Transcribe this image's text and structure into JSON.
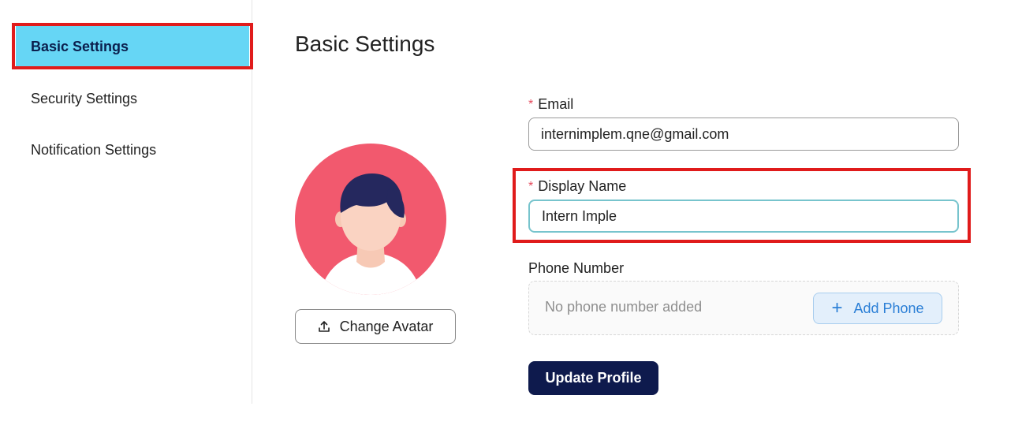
{
  "sidebar": {
    "items": [
      {
        "label": "Basic Settings",
        "active": true
      },
      {
        "label": "Security Settings",
        "active": false
      },
      {
        "label": "Notification Settings",
        "active": false
      }
    ]
  },
  "main": {
    "title": "Basic Settings",
    "avatar": {
      "change_label": "Change Avatar",
      "icon": "upload-icon"
    },
    "form": {
      "email": {
        "label": "Email",
        "required_mark": "*",
        "value": "internimplem.qne@gmail.com"
      },
      "display_name": {
        "label": "Display Name",
        "required_mark": "*",
        "value": "Intern Imple"
      },
      "phone": {
        "label": "Phone Number",
        "empty_text": "No phone number added",
        "add_label": "Add Phone",
        "add_icon": "plus-icon"
      },
      "submit_label": "Update Profile"
    }
  },
  "colors": {
    "sidebar_active_bg": "#66d6f5",
    "highlight": "#e01b1b",
    "primary_button": "#0e1a4d",
    "avatar_bg": "#f2596e",
    "add_phone_text": "#2b7fd6",
    "required": "#e5475a"
  }
}
